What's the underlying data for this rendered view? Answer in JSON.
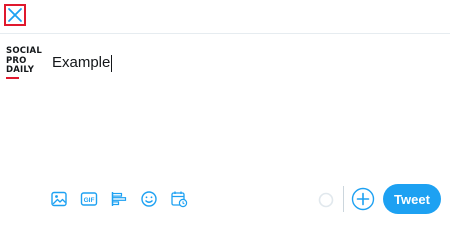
{
  "header": {
    "close_icon": "close-icon"
  },
  "account": {
    "logo_lines": [
      "SOCIAL",
      "PRO",
      "DAILY"
    ]
  },
  "composer": {
    "text": "Example"
  },
  "toolbar": {
    "tools": [
      "image-icon",
      "gif-icon",
      "poll-icon",
      "emoji-icon",
      "schedule-icon"
    ],
    "add_icon": "plus-circle-icon",
    "tweet_label": "Tweet"
  },
  "colors": {
    "accent": "#1da1f2",
    "highlight": "#e0182d",
    "divider": "#e6ecf0"
  }
}
